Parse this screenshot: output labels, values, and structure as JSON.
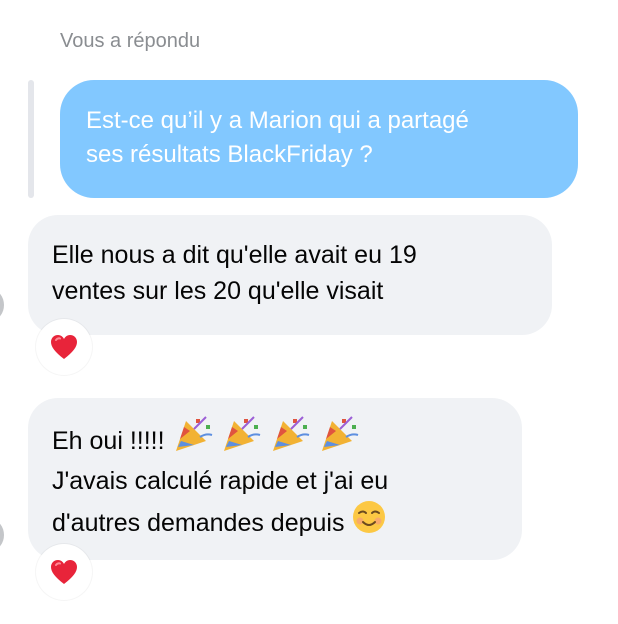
{
  "reply": {
    "header": "Vous a répondu",
    "quoted_lines": [
      "Est-ce qu’il y a Marion qui a partagé",
      "ses résultats BlackFriday ?"
    ]
  },
  "messages": [
    {
      "lines": [
        "Elle nous a dit qu'elle avait eu 19",
        "ventes sur les 20 qu'elle visait"
      ],
      "reaction": "heart-icon"
    },
    {
      "lines": [
        "Eh oui !!!!! ",
        "J'avais calculé rapide et j'ai eu",
        "d'autres demandes depuis "
      ],
      "line1_emoji": [
        "party-popper-icon",
        "party-popper-icon",
        "party-popper-icon",
        "party-popper-icon"
      ],
      "line3_emoji": "smiling-face-icon",
      "reaction": "heart-icon"
    }
  ],
  "colors": {
    "quoted_bubble": "#82c8ff",
    "incoming_bubble": "#f0f2f5",
    "header_text": "#8a8d91",
    "heart": "#e8243a"
  }
}
